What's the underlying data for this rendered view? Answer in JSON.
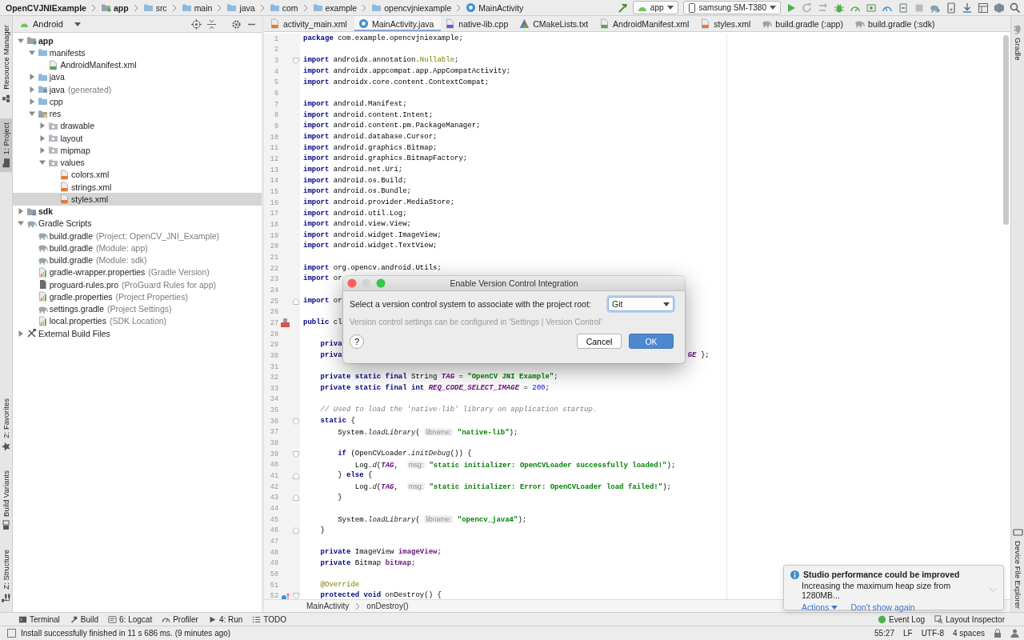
{
  "nav_bar": {
    "breadcrumbs": [
      {
        "label": "OpenCVJNIExample",
        "kind": "root"
      },
      {
        "label": "app",
        "kind": "module"
      },
      {
        "label": "src",
        "kind": "folder"
      },
      {
        "label": "main",
        "kind": "folder"
      },
      {
        "label": "java",
        "kind": "source"
      },
      {
        "label": "com",
        "kind": "folder"
      },
      {
        "label": "example",
        "kind": "folder"
      },
      {
        "label": "opencvjniexample",
        "kind": "folder"
      },
      {
        "label": "MainActivity",
        "kind": "class"
      }
    ],
    "run_config": "app",
    "device": "samsung SM-T380"
  },
  "left_tool_tabs_top": [
    {
      "label": "Resource Manager",
      "kind": "resources",
      "selected": false
    },
    {
      "label": "1: Project",
      "kind": "project",
      "selected": true
    }
  ],
  "left_tool_tabs_bottom": [
    {
      "label": "2: Favorites",
      "kind": "favorites",
      "selected": false
    },
    {
      "label": "Build Variants",
      "kind": "variants",
      "selected": false
    },
    {
      "label": "Z: Structure",
      "kind": "structure",
      "selected": false
    }
  ],
  "right_tool_tabs_top": [
    {
      "label": "Gradle",
      "kind": "gradle",
      "selected": false
    }
  ],
  "right_tool_tabs_bottom": [
    {
      "label": "Device File Explorer",
      "kind": "device",
      "selected": false
    }
  ],
  "project_panel": {
    "view": "Android",
    "tree": [
      {
        "label": "app",
        "kind": "module",
        "expanded": true,
        "selected": false,
        "children": [
          {
            "label": "manifests",
            "kind": "folder",
            "expanded": true,
            "selected": false,
            "children": [
              {
                "label": "AndroidManifest.xml",
                "kind": "manifest",
                "selected": false
              }
            ]
          },
          {
            "label": "java",
            "kind": "folder",
            "expanded": false,
            "selected": false
          },
          {
            "label": "java",
            "note": "(generated)",
            "kind": "generated",
            "expanded": false,
            "selected": false
          },
          {
            "label": "cpp",
            "kind": "folder",
            "expanded": false,
            "selected": false
          },
          {
            "label": "res",
            "kind": "res",
            "expanded": true,
            "selected": false,
            "children": [
              {
                "label": "drawable",
                "kind": "subfolder",
                "expanded": false,
                "selected": false
              },
              {
                "label": "layout",
                "kind": "subfolder",
                "expanded": false,
                "selected": false
              },
              {
                "label": "mipmap",
                "kind": "subfolder",
                "expanded": false,
                "selected": false
              },
              {
                "label": "values",
                "kind": "subfolder",
                "expanded": true,
                "selected": false,
                "children": [
                  {
                    "label": "colors.xml",
                    "kind": "xml",
                    "selected": false
                  },
                  {
                    "label": "strings.xml",
                    "kind": "xml",
                    "selected": false
                  },
                  {
                    "label": "styles.xml",
                    "kind": "xml",
                    "selected": true
                  }
                ]
              }
            ]
          }
        ]
      },
      {
        "label": "sdk",
        "kind": "libmodule",
        "expanded": false,
        "selected": false
      },
      {
        "label": "Gradle Scripts",
        "kind": "gradle",
        "expanded": true,
        "selected": false,
        "children": [
          {
            "label": "build.gradle",
            "note": "(Project: OpenCV_JNI_Example)",
            "kind": "gradle",
            "selected": false
          },
          {
            "label": "build.gradle",
            "note": "(Module: app)",
            "kind": "gradle",
            "selected": false
          },
          {
            "label": "build.gradle",
            "note": "(Module: sdk)",
            "kind": "gradle",
            "selected": false
          },
          {
            "label": "gradle-wrapper.properties",
            "note": "(Gradle Version)",
            "kind": "props",
            "selected": false
          },
          {
            "label": "proguard-rules.pro",
            "note": "(ProGuard Rules for app)",
            "kind": "pro",
            "selected": false
          },
          {
            "label": "gradle.properties",
            "note": "(Project Properties)",
            "kind": "props",
            "selected": false
          },
          {
            "label": "settings.gradle",
            "note": "(Project Settings)",
            "kind": "gradle",
            "selected": false
          },
          {
            "label": "local.properties",
            "note": "(SDK Location)",
            "kind": "props",
            "selected": false
          }
        ]
      },
      {
        "label": "External Build Files",
        "kind": "tools",
        "expanded": false,
        "selected": false
      }
    ]
  },
  "editor": {
    "tabs": [
      {
        "label": "activity_main.xml",
        "kind": "xml",
        "selected": false
      },
      {
        "label": "MainActivity.java",
        "kind": "class",
        "selected": true
      },
      {
        "label": "native-lib.cpp",
        "kind": "cpp",
        "selected": false
      },
      {
        "label": "CMakeLists.txt",
        "kind": "cmake",
        "selected": false
      },
      {
        "label": "AndroidManifest.xml",
        "kind": "manifest",
        "selected": false
      },
      {
        "label": "styles.xml",
        "kind": "xml",
        "selected": false
      },
      {
        "label": "build.gradle (:app)",
        "kind": "gradle",
        "selected": false
      },
      {
        "label": "build.gradle (:sdk)",
        "kind": "gradle",
        "selected": false
      }
    ],
    "lines": [
      {
        "number": "1",
        "tokens": [
          {
            "kind": "kw",
            "text": "package"
          },
          {
            "kind": "plain",
            "text": " com.example.opencvjniexample;"
          }
        ]
      },
      {
        "number": "2"
      },
      {
        "number": "3",
        "fold_start": true,
        "tokens": [
          {
            "kind": "kw",
            "text": "import"
          },
          {
            "kind": "plain",
            "text": " androidx.annotation."
          },
          {
            "kind": "ann",
            "text": "Nullable"
          },
          {
            "kind": "plain",
            "text": ";"
          }
        ]
      },
      {
        "number": "4",
        "tokens": [
          {
            "kind": "kw",
            "text": "import"
          },
          {
            "kind": "plain",
            "text": " androidx.appcompat.app.AppCompatActivity;"
          }
        ]
      },
      {
        "number": "5",
        "tokens": [
          {
            "kind": "kw",
            "text": "import"
          },
          {
            "kind": "plain",
            "text": " androidx.core.content.ContextCompat;"
          }
        ]
      },
      {
        "number": "6"
      },
      {
        "number": "7",
        "tokens": [
          {
            "kind": "kw",
            "text": "import"
          },
          {
            "kind": "plain",
            "text": " android.Manifest;"
          }
        ]
      },
      {
        "number": "8",
        "tokens": [
          {
            "kind": "kw",
            "text": "import"
          },
          {
            "kind": "plain",
            "text": " android.content.Intent;"
          }
        ]
      },
      {
        "number": "9",
        "tokens": [
          {
            "kind": "kw",
            "text": "import"
          },
          {
            "kind": "plain",
            "text": " android.content.pm.PackageManager;"
          }
        ]
      },
      {
        "number": "10",
        "tokens": [
          {
            "kind": "kw",
            "text": "import"
          },
          {
            "kind": "plain",
            "text": " android.database.Cursor;"
          }
        ]
      },
      {
        "number": "11",
        "tokens": [
          {
            "kind": "kw",
            "text": "import"
          },
          {
            "kind": "plain",
            "text": " android.graphics.Bitmap;"
          }
        ]
      },
      {
        "number": "12",
        "tokens": [
          {
            "kind": "kw",
            "text": "import"
          },
          {
            "kind": "plain",
            "text": " android.graphics.BitmapFactory;"
          }
        ]
      },
      {
        "number": "13",
        "tokens": [
          {
            "kind": "kw",
            "text": "import"
          },
          {
            "kind": "plain",
            "text": " android.net.Uri;"
          }
        ]
      },
      {
        "number": "14",
        "tokens": [
          {
            "kind": "kw",
            "text": "import"
          },
          {
            "kind": "plain",
            "text": " android.os.Build;"
          }
        ]
      },
      {
        "number": "15",
        "tokens": [
          {
            "kind": "kw",
            "text": "import"
          },
          {
            "kind": "plain",
            "text": " android.os.Bundle;"
          }
        ]
      },
      {
        "number": "16",
        "tokens": [
          {
            "kind": "kw",
            "text": "import"
          },
          {
            "kind": "plain",
            "text": " android.provider.MediaStore;"
          }
        ]
      },
      {
        "number": "17",
        "tokens": [
          {
            "kind": "kw",
            "text": "import"
          },
          {
            "kind": "plain",
            "text": " android.util.Log;"
          }
        ]
      },
      {
        "number": "18",
        "tokens": [
          {
            "kind": "kw",
            "text": "import"
          },
          {
            "kind": "plain",
            "text": " android.view.View;"
          }
        ]
      },
      {
        "number": "19",
        "tokens": [
          {
            "kind": "kw",
            "text": "import"
          },
          {
            "kind": "plain",
            "text": " android.widget.ImageView;"
          }
        ]
      },
      {
        "number": "20",
        "tokens": [
          {
            "kind": "kw",
            "text": "import"
          },
          {
            "kind": "plain",
            "text": " android.widget.TextView;"
          }
        ]
      },
      {
        "number": "21"
      },
      {
        "number": "22",
        "tokens": [
          {
            "kind": "kw",
            "text": "import"
          },
          {
            "kind": "plain",
            "text": " org.opencv.android.Utils;"
          }
        ]
      },
      {
        "number": "23",
        "tokens": [
          {
            "kind": "kw",
            "text": "import"
          },
          {
            "kind": "plain",
            "text": " or"
          }
        ]
      },
      {
        "number": "24"
      },
      {
        "number": "25",
        "fold_end": true,
        "tokens": [
          {
            "kind": "kw",
            "text": "import"
          },
          {
            "kind": "plain",
            "text": " or"
          }
        ]
      },
      {
        "number": "26"
      },
      {
        "number": "27",
        "class_marker": true,
        "tokens": [
          {
            "kind": "kw",
            "text": "public"
          },
          {
            "kind": "plain",
            "text": " cl"
          }
        ]
      },
      {
        "number": "28"
      },
      {
        "number": "29",
        "tokens": [
          {
            "kind": "kw",
            "text": "    priva"
          }
        ]
      },
      {
        "number": "30",
        "tokens": [
          {
            "kind": "kw",
            "text": "    priva"
          }
        ],
        "tail": [
          {
            "kind": "const",
            "text": "GE"
          },
          {
            "kind": "plain",
            "text": " };"
          }
        ]
      },
      {
        "number": "31"
      },
      {
        "number": "32",
        "tokens": [
          {
            "kind": "kw",
            "text": "    private static final"
          },
          {
            "kind": "plain",
            "text": " String "
          },
          {
            "kind": "const",
            "text": "TAG"
          },
          {
            "kind": "plain",
            "text": " = "
          },
          {
            "kind": "str",
            "text": "\"OpenCV JNI Example\""
          },
          {
            "kind": "plain",
            "text": ";"
          }
        ]
      },
      {
        "number": "33",
        "tokens": [
          {
            "kind": "kw",
            "text": "    private static final int "
          },
          {
            "kind": "const",
            "text": "REQ_CODE_SELECT_IMAGE"
          },
          {
            "kind": "plain",
            "text": " = "
          },
          {
            "kind": "num",
            "text": "200"
          },
          {
            "kind": "plain",
            "text": ";"
          }
        ]
      },
      {
        "number": "34"
      },
      {
        "number": "35",
        "tokens": [
          {
            "kind": "comment",
            "text": "    // Used to load the 'native-lib' library on application startup."
          }
        ]
      },
      {
        "number": "36",
        "fold_start": true,
        "tokens": [
          {
            "kind": "kw",
            "text": "    static"
          },
          {
            "kind": "plain",
            "text": " {"
          }
        ]
      },
      {
        "number": "37",
        "tokens": [
          {
            "kind": "plain",
            "text": "        System."
          },
          {
            "kind": "call",
            "text": "loadLibrary"
          },
          {
            "kind": "plain",
            "text": "( "
          },
          {
            "kind": "hint",
            "text": "libname:"
          },
          {
            "kind": "str",
            "text": " \"native-lib\""
          },
          {
            "kind": "plain",
            "text": ");"
          }
        ]
      },
      {
        "number": "38"
      },
      {
        "number": "39",
        "fold_start": true,
        "tokens": [
          {
            "kind": "kw",
            "text": "        if"
          },
          {
            "kind": "plain",
            "text": " (OpenCVLoader."
          },
          {
            "kind": "call",
            "text": "initDebug"
          },
          {
            "kind": "plain",
            "text": "()) {"
          }
        ]
      },
      {
        "number": "40",
        "tokens": [
          {
            "kind": "plain",
            "text": "            Log."
          },
          {
            "kind": "call",
            "text": "d"
          },
          {
            "kind": "plain",
            "text": "("
          },
          {
            "kind": "const",
            "text": "TAG"
          },
          {
            "kind": "plain",
            "text": ",  "
          },
          {
            "kind": "hint",
            "text": "msg:"
          },
          {
            "kind": "str",
            "text": " \"static initializer: OpenCVLoader successfully loaded!\""
          },
          {
            "kind": "plain",
            "text": ");"
          }
        ]
      },
      {
        "number": "41",
        "fold_end": true,
        "tokens": [
          {
            "kind": "plain",
            "text": "        } "
          },
          {
            "kind": "kw",
            "text": "else"
          },
          {
            "kind": "plain",
            "text": " {"
          }
        ]
      },
      {
        "number": "42",
        "tokens": [
          {
            "kind": "plain",
            "text": "            Log."
          },
          {
            "kind": "call",
            "text": "d"
          },
          {
            "kind": "plain",
            "text": "("
          },
          {
            "kind": "const",
            "text": "TAG"
          },
          {
            "kind": "plain",
            "text": ",  "
          },
          {
            "kind": "hint",
            "text": "msg:"
          },
          {
            "kind": "str",
            "text": " \"static initializer: Error: OpenCVLoader load failed!\""
          },
          {
            "kind": "plain",
            "text": ");"
          }
        ]
      },
      {
        "number": "43",
        "fold_end": true,
        "tokens": [
          {
            "kind": "plain",
            "text": "        }"
          }
        ]
      },
      {
        "number": "44"
      },
      {
        "number": "45",
        "tokens": [
          {
            "kind": "plain",
            "text": "        System."
          },
          {
            "kind": "call",
            "text": "loadLibrary"
          },
          {
            "kind": "plain",
            "text": "( "
          },
          {
            "kind": "hint",
            "text": "libname:"
          },
          {
            "kind": "str",
            "text": " \"opencv_java4\""
          },
          {
            "kind": "plain",
            "text": ");"
          }
        ]
      },
      {
        "number": "46",
        "fold_end": true,
        "tokens": [
          {
            "kind": "plain",
            "text": "    }"
          }
        ]
      },
      {
        "number": "47"
      },
      {
        "number": "48",
        "tokens": [
          {
            "kind": "kw",
            "text": "    private"
          },
          {
            "kind": "plain",
            "text": " ImageView "
          },
          {
            "kind": "field",
            "text": "imageView"
          },
          {
            "kind": "plain",
            "text": ";"
          }
        ]
      },
      {
        "number": "49",
        "tokens": [
          {
            "kind": "kw",
            "text": "    private"
          },
          {
            "kind": "plain",
            "text": " Bitmap "
          },
          {
            "kind": "field",
            "text": "bitmap"
          },
          {
            "kind": "plain",
            "text": ";"
          }
        ]
      },
      {
        "number": "50"
      },
      {
        "number": "51",
        "tokens": [
          {
            "kind": "ann",
            "text": "    @Override"
          }
        ]
      },
      {
        "number": "52",
        "override_marker": true,
        "fold_start": true,
        "tokens": [
          {
            "kind": "kw",
            "text": "    protected void"
          },
          {
            "kind": "plain",
            "text": " onDestroy() {"
          }
        ]
      }
    ],
    "breadcrumbs": [
      "MainActivity",
      "onDestroy()"
    ]
  },
  "dialog": {
    "title": "Enable Version Control Integration",
    "prompt": "Select a version control system to associate with the project root:",
    "vcs_select": {
      "value": "Git"
    },
    "hint": "Version control settings can be configured in 'Settings | Version Control'",
    "help_label": "?",
    "buttons": [
      {
        "label": "Cancel",
        "default": false
      },
      {
        "label": "OK",
        "default": true
      }
    ]
  },
  "notification": {
    "title": "Studio performance could be improved",
    "message": "Increasing the maximum heap size from 1280MB...",
    "actions": [
      {
        "label": "Actions",
        "kind": "menu"
      },
      {
        "label": "Don't show again",
        "kind": "link"
      }
    ]
  },
  "bottom_tool_tabs": [
    {
      "label": "Terminal",
      "kind": "terminal"
    },
    {
      "label": "Build",
      "kind": "build"
    },
    {
      "label": "6: Logcat",
      "kind": "logcat"
    },
    {
      "label": "Profiler",
      "kind": "profiler"
    },
    {
      "label": "4: Run",
      "kind": "run"
    },
    {
      "label": "TODO",
      "kind": "todo"
    }
  ],
  "bottom_tool_tabs_right": [
    {
      "label": "Event Log",
      "kind": "eventlog"
    },
    {
      "label": "Layout Inspector",
      "kind": "inspector"
    }
  ],
  "status_bar": {
    "message": "Install successfully finished in 11 s 686 ms. (9 minutes ago)",
    "items": [
      "55:27",
      "LF",
      "UTF-8",
      "4 spaces"
    ]
  }
}
